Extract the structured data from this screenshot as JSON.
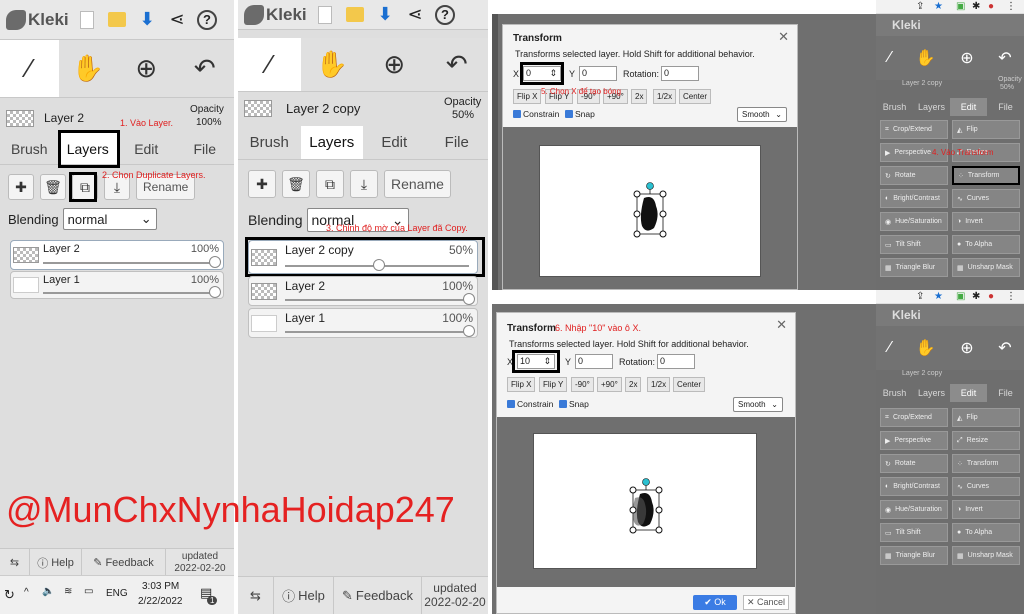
{
  "app": {
    "name": "Kleki"
  },
  "panel1": {
    "layer_title": "Layer 2",
    "opacity_label": "Opacity",
    "opacity_value": "100%",
    "tabs": [
      "Brush",
      "Layers",
      "Edit",
      "File"
    ],
    "rename_label": "Rename",
    "blending_label": "Blending",
    "blending_value": "normal",
    "layers": [
      {
        "name": "Layer 2",
        "opacity": "100%"
      },
      {
        "name": "Layer 1",
        "opacity": "100%"
      }
    ],
    "footer": {
      "help": "Help",
      "feedback": "Feedback",
      "updated_label": "updated",
      "updated_date": "2022-02-20"
    }
  },
  "panel2": {
    "layer_title": "Layer 2 copy",
    "opacity_label": "Opacity",
    "opacity_value": "50%",
    "tabs": [
      "Brush",
      "Layers",
      "Edit",
      "File"
    ],
    "rename_label": "Rename",
    "blending_label": "Blending",
    "blending_value": "normal",
    "layers": [
      {
        "name": "Layer 2 copy",
        "opacity": "50%"
      },
      {
        "name": "Layer 2",
        "opacity": "100%"
      },
      {
        "name": "Layer 1",
        "opacity": "100%"
      }
    ],
    "footer": {
      "help": "Help",
      "feedback": "Feedback",
      "updated_label": "updated",
      "updated_date": "2022-02-20"
    }
  },
  "dialog": {
    "title": "Transform",
    "description": "Transforms selected layer. Hold Shift for additional behavior.",
    "x_label": "X",
    "y_label": "Y",
    "rotation_label": "Rotation:",
    "y_value": "0",
    "rotation_value": "0",
    "buttons": [
      "Flip X",
      "Flip Y",
      "-90°",
      "+90°",
      "2x",
      "1/2x",
      "Center"
    ],
    "constrain_label": "Constrain",
    "snap_label": "Snap",
    "interp_value": "Smooth",
    "ok_label": "Ok",
    "cancel_label": "Cancel"
  },
  "dialog_top": {
    "x_value": "0"
  },
  "dialog_bottom": {
    "x_value": "10"
  },
  "mini_panel": {
    "layer_name": "Layer 2 copy",
    "opacity_label": "Opacity",
    "opacity_value": "50%",
    "tabs": [
      "Brush",
      "Layers",
      "Edit",
      "File"
    ],
    "buttons": [
      "Crop/Extend",
      "Flip",
      "Perspective",
      "Resize",
      "Rotate",
      "Transform",
      "Bright/Contrast",
      "Curves",
      "Hue/Saturation",
      "Invert",
      "Tilt Shift",
      "To Alpha",
      "Triangle Blur",
      "Unsharp Mask"
    ]
  },
  "callouts": {
    "c1": "1. Vào Layer.",
    "c2": "2. Chọn Duplicate Layers.",
    "c3": "3. Chỉnh độ mờ của Layer đã Copy.",
    "c4": "4. Vào Transform",
    "c5": "5. Chọn X để tạo bóng",
    "c6": "6. Nhập \"10\" vào ô X."
  },
  "watermark": "@MunChxNynhaHoidap247",
  "taskbar": {
    "lang": "ENG",
    "time": "3:03 PM",
    "date": "2/22/2022",
    "notif_count": "1"
  }
}
